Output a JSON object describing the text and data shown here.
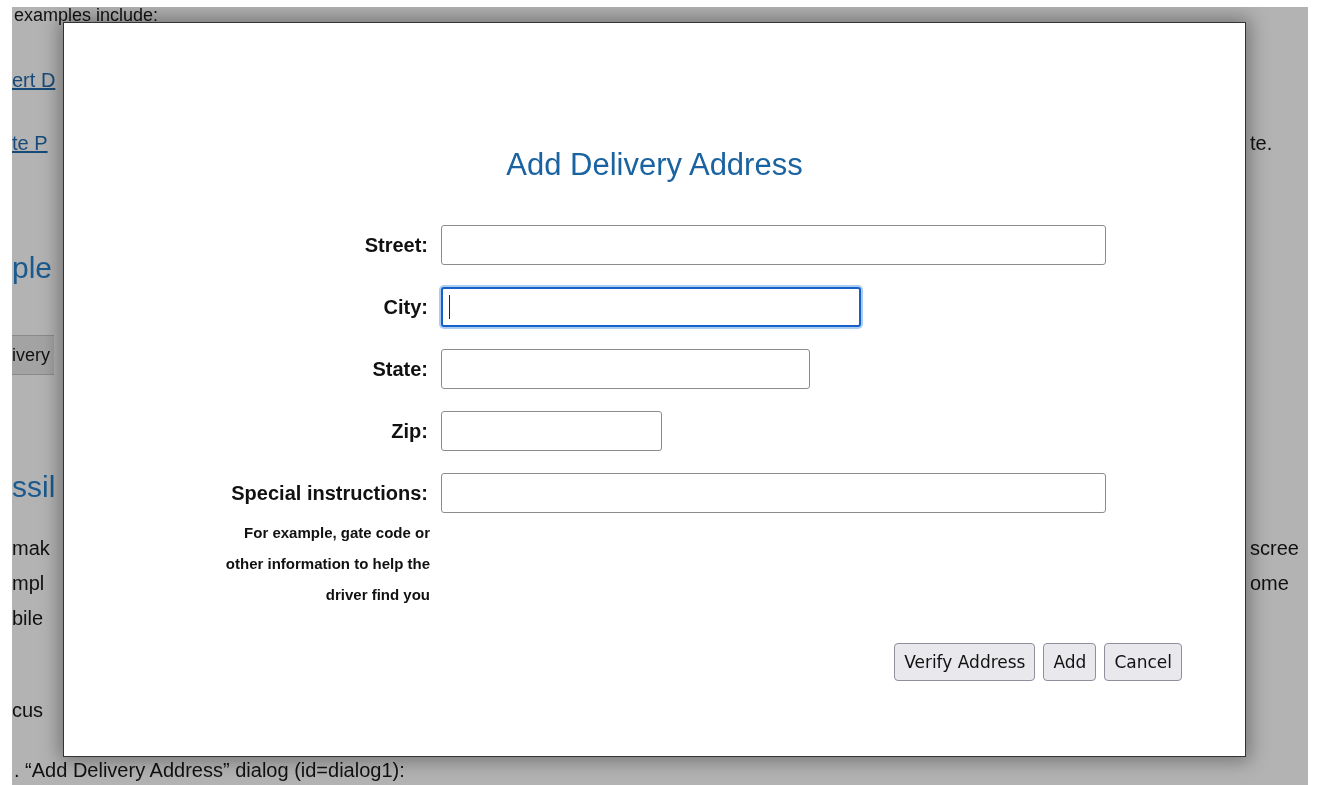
{
  "background": {
    "intro": "examples include:",
    "left_fragments": [
      {
        "kind": "link",
        "text": "ert D"
      },
      {
        "kind": "link",
        "text": "te P"
      },
      {
        "kind": "heading",
        "text": "ple"
      },
      {
        "kind": "button",
        "text": "ivery"
      },
      {
        "kind": "heading",
        "text": "ssil"
      },
      {
        "kind": "text",
        "text": "mak"
      },
      {
        "kind": "text",
        "text": "mpl"
      },
      {
        "kind": "text",
        "text": "bile"
      },
      {
        "kind": "text",
        "text": "cus"
      }
    ],
    "right_fragments": [
      {
        "kind": "text",
        "text": "te."
      },
      {
        "kind": "text",
        "text": "scree"
      },
      {
        "kind": "text",
        "text": "ome"
      }
    ],
    "bottom_line": ". “Add Delivery Address” dialog (id=dialog1):"
  },
  "dialog": {
    "title": "Add Delivery Address",
    "fields": [
      {
        "label": "Street:",
        "focused": false
      },
      {
        "label": "City:",
        "focused": true
      },
      {
        "label": "State:",
        "focused": false
      },
      {
        "label": "Zip:",
        "focused": false
      },
      {
        "label": "Special instructions:",
        "focused": false,
        "hint": "For example, gate code or other information to help the driver find you"
      }
    ],
    "buttons": [
      "Verify Address",
      "Add",
      "Cancel"
    ]
  }
}
